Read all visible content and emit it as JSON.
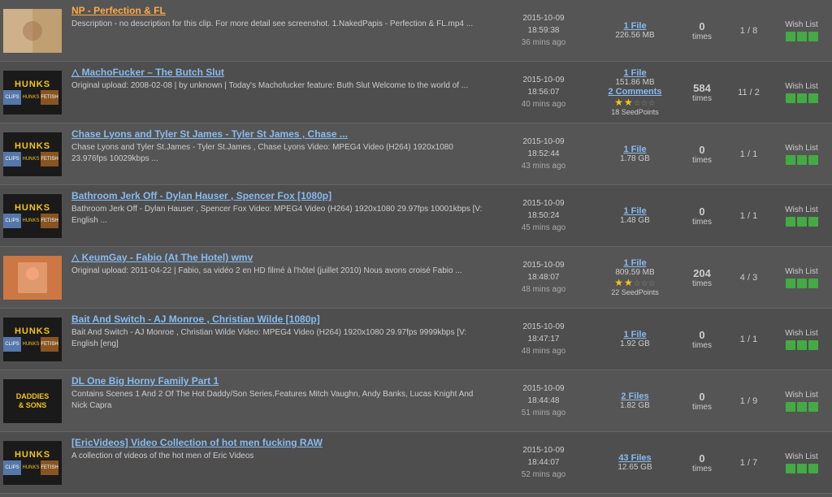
{
  "items": [
    {
      "id": 1,
      "title": "NP - Perfection & FL",
      "title_color": "orange",
      "description": "Description - no description for this clip. For more detail see screenshot. 1.NakedPapis - Perfection & FL.mp4 ...",
      "date": "2015-10-09",
      "time": "18:59:38",
      "ago": "36 mins ago",
      "files": "1 File",
      "size": "226.56 MB",
      "comments": null,
      "rating_full": 0,
      "rating_empty": 0,
      "seed_points": null,
      "times": "0",
      "pagination": "1 / 8",
      "wishlist": "Wish List",
      "thumb_type": "np"
    },
    {
      "id": 2,
      "title": "△ MachoFucker – The Butch Slut",
      "title_color": "blue",
      "description": "Original upload: 2008-02-08 | by unknown | Today's Machofucker feature: Buth Slut Welcome to the world of ...",
      "date": "2015-10-09",
      "time": "18:56:07",
      "ago": "40 mins ago",
      "files": "1 File",
      "size": "151.86 MB",
      "comments": "2 Comments",
      "rating_full": 2,
      "rating_empty": 3,
      "seed_points": "18 SeedPoints",
      "times": "584",
      "pagination": "11 / 2",
      "wishlist": "Wish List",
      "thumb_type": "hunks_mini"
    },
    {
      "id": 3,
      "title": "Chase Lyons and Tyler St James - Tyler St James , Chase ...",
      "title_color": "blue",
      "description": "Chase Lyons and Tyler St.James - Tyler St.James , Chase Lyons Video: MPEG4 Video (H264) 1920x1080 23.976fps 10029kbps ...",
      "date": "2015-10-09",
      "time": "18:52:44",
      "ago": "43 mins ago",
      "files": "1 File",
      "size": "1.78 GB",
      "comments": null,
      "rating_full": 0,
      "rating_empty": 0,
      "seed_points": null,
      "times": "0",
      "pagination": "1 / 1",
      "wishlist": "Wish List",
      "thumb_type": "hunks"
    },
    {
      "id": 4,
      "title": "Bathroom Jerk Off - Dylan Hauser , Spencer Fox [1080p]",
      "title_color": "blue",
      "description": "Bathroom Jerk Off - Dylan Hauser , Spencer Fox Video: MPEG4 Video (H264) 1920x1080 29.97fps 10001kbps [V: English ...",
      "date": "2015-10-09",
      "time": "18:50:24",
      "ago": "45 mins ago",
      "files": "1 File",
      "size": "1.48 GB",
      "comments": null,
      "rating_full": 0,
      "rating_empty": 0,
      "seed_points": null,
      "times": "0",
      "pagination": "1 / 1",
      "wishlist": "Wish List",
      "thumb_type": "hunks"
    },
    {
      "id": 5,
      "title": "△ KeumGay - Fabio (At The Hotel) wmv",
      "title_color": "blue",
      "description": "Original upload: 2011-04-22 | Fabio, sa vidéo 2 en HD filmé à l'hôtel (juillet 2010) Nous avons croisé Fabio ...",
      "date": "2015-10-09",
      "time": "18:48:07",
      "ago": "48 mins ago",
      "files": "1 File",
      "size": "809.59 MB",
      "comments": null,
      "rating_full": 2,
      "rating_empty": 3,
      "seed_points": "22 SeedPoints",
      "times": "204",
      "pagination": "4 / 3",
      "wishlist": "Wish List",
      "thumb_type": "keumgay"
    },
    {
      "id": 6,
      "title": "Bait And Switch - AJ Monroe , Christian Wilde [1080p]",
      "title_color": "blue",
      "description": "Bait And Switch - AJ Monroe , Christian Wilde Video: MPEG4 Video (H264) 1920x1080 29.97fps 9999kbps [V: English [eng]",
      "date": "2015-10-09",
      "time": "18:47:17",
      "ago": "48 mins ago",
      "files": "1 File",
      "size": "1.92 GB",
      "comments": null,
      "rating_full": 0,
      "rating_empty": 0,
      "seed_points": null,
      "times": "0",
      "pagination": "1 / 1",
      "wishlist": "Wish List",
      "thumb_type": "hunks"
    },
    {
      "id": 7,
      "title": "DL One Big Horny Family Part 1",
      "title_color": "blue",
      "description": "Contains Scenes 1 And 2 Of The Hot Daddy/Son Series.Features Mitch Vaughn, Andy Banks, Lucas Knight And Nick Capra",
      "date": "2015-10-09",
      "time": "18:44:48",
      "ago": "51 mins ago",
      "files": "2 Files",
      "size": "1.82 GB",
      "comments": null,
      "rating_full": 0,
      "rating_empty": 0,
      "seed_points": null,
      "times": "0",
      "pagination": "1 / 9",
      "wishlist": "Wish List",
      "thumb_type": "daddies"
    },
    {
      "id": 8,
      "title": "[EricVideos] Video Collection of hot men fucking RAW",
      "title_color": "blue",
      "description": "A collection of videos of the hot men of Eric Videos",
      "date": "2015-10-09",
      "time": "18:44:07",
      "ago": "52 mins ago",
      "files": "43 Files",
      "size": "12.65 GB",
      "comments": null,
      "rating_full": 0,
      "rating_empty": 0,
      "seed_points": null,
      "times": "0",
      "pagination": "1 / 7",
      "wishlist": "Wish List",
      "thumb_type": "hunks_mini2"
    }
  ]
}
